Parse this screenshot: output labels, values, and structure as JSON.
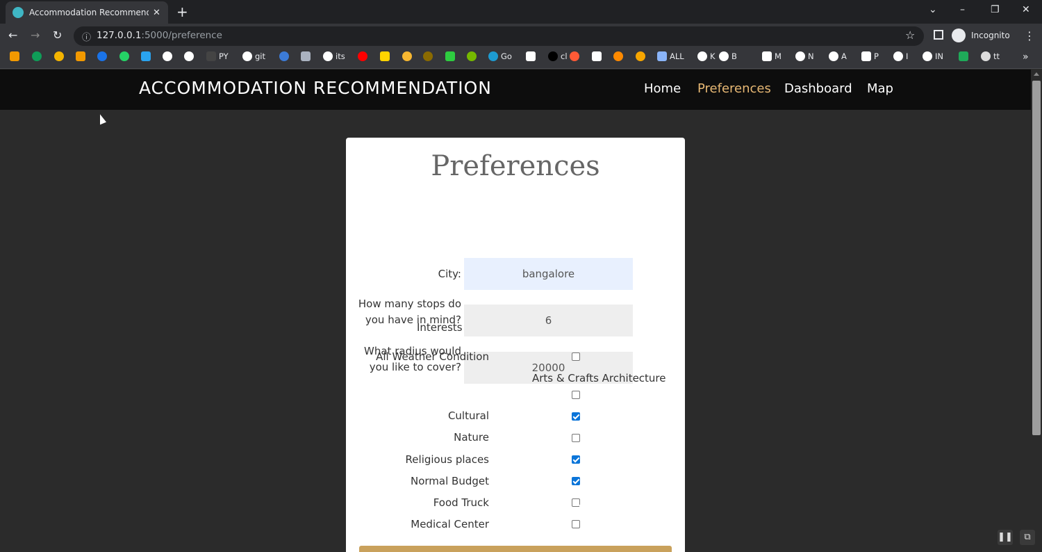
{
  "browser": {
    "tab_title": "Accommodation Recommendation",
    "tab_close": "✕",
    "new_tab": "+",
    "url_host": "127.0.0.1",
    "url_path": ":5000/preference",
    "profile_label": "Incognito",
    "bookmarks": [
      {
        "label": "",
        "color": "#f29900"
      },
      {
        "label": "",
        "color": "#0f9d58"
      },
      {
        "label": "",
        "color": "#f4b400"
      },
      {
        "label": "",
        "color": "#f29900"
      },
      {
        "label": "",
        "color": "#1a73e8"
      },
      {
        "label": "",
        "color": "#25d366"
      },
      {
        "label": "",
        "color": "#2aa3ef"
      },
      {
        "label": "",
        "color": "#ffffff"
      },
      {
        "label": "",
        "color": "#ffffff"
      },
      {
        "label": "PY",
        "color": "#444444"
      },
      {
        "label": "git",
        "color": "#ffffff"
      },
      {
        "label": "",
        "color": "#3c7bd6"
      },
      {
        "label": "",
        "color": "#aab2c0"
      },
      {
        "label": "its",
        "color": "#ffffff"
      },
      {
        "label": "",
        "color": "#ff0000"
      },
      {
        "label": "",
        "color": "#ffd400"
      },
      {
        "label": "",
        "color": "#f7b731"
      },
      {
        "label": "",
        "color": "#8a6a00"
      },
      {
        "label": "",
        "color": "#2ecc40"
      },
      {
        "label": "",
        "color": "#76b900"
      },
      {
        "label": "Go",
        "color": "#1d9bd1"
      },
      {
        "label": "",
        "color": "#ffffff"
      },
      {
        "label": "cl",
        "color": "#000000"
      },
      {
        "label": "",
        "color": "#ff5a36"
      },
      {
        "label": "",
        "color": "#ffffff"
      },
      {
        "label": "",
        "color": "#ff8a00"
      },
      {
        "label": "",
        "color": "#f7a600"
      },
      {
        "label": "ALL",
        "color": "#8ab4f8"
      },
      {
        "label": "K",
        "color": "#ffffff"
      },
      {
        "label": "B",
        "color": "#ffffff"
      },
      {
        "label": "M",
        "color": "#ffffff"
      },
      {
        "label": "N",
        "color": "#ffffff"
      },
      {
        "label": "A",
        "color": "#ffffff"
      },
      {
        "label": "P",
        "color": "#ffffff"
      },
      {
        "label": "I",
        "color": "#ffffff"
      },
      {
        "label": "IN",
        "color": "#ffffff"
      },
      {
        "label": "",
        "color": "#1faa59"
      },
      {
        "label": "tt",
        "color": "#dddddd"
      }
    ],
    "bookmarks_overflow": "»"
  },
  "navbar": {
    "brand": "ACCOMMODATION RECOMMENDATION",
    "links": [
      {
        "label": "Home",
        "active": false
      },
      {
        "label": "Preferences",
        "active": true
      },
      {
        "label": "Dashboard",
        "active": false
      },
      {
        "label": "Map",
        "active": false
      }
    ],
    "accent_color": "#e7b874"
  },
  "form": {
    "title": "Preferences",
    "city_label": "City:",
    "city_value": "bangalore",
    "stops_label": "How many stops do you have in mind?",
    "stops_value": "6",
    "radius_label": "What radius would you like to cover?",
    "radius_value": "20000",
    "interests_label": "Interests",
    "interests": [
      {
        "label": "All Weather Condition",
        "checked": false
      },
      {
        "label": "Arts & Crafts Architecture",
        "checked": false
      },
      {
        "label": "Cultural",
        "checked": true
      },
      {
        "label": "Nature",
        "checked": false
      },
      {
        "label": "Religious places",
        "checked": true
      },
      {
        "label": "Normal Budget",
        "checked": true
      },
      {
        "label": "Food Truck",
        "checked": false
      },
      {
        "label": "Medical Center",
        "checked": false
      }
    ],
    "checkbox_checked_color": "#0b75d9",
    "submit_color": "#c9a15c"
  }
}
